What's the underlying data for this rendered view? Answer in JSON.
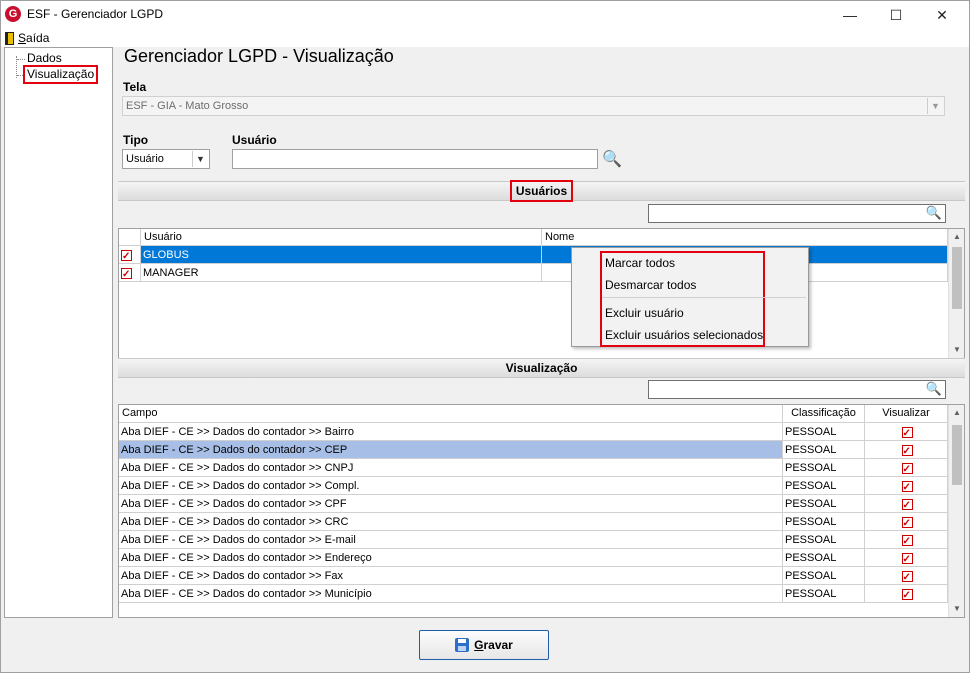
{
  "window": {
    "title": "ESF - Gerenciador LGPD",
    "app_icon_letter": "G",
    "minimize": "—",
    "maximize": "☐",
    "close": "✕"
  },
  "menu": {
    "exit_label_u": "S",
    "exit_label_rest": "aída"
  },
  "tree": {
    "items": [
      "Dados",
      "Visualização"
    ]
  },
  "page": {
    "title": "Gerenciador LGPD - Visualização"
  },
  "tela": {
    "label": "Tela",
    "value": "ESF - GIA - Mato Grosso"
  },
  "tipo": {
    "label": "Tipo",
    "value": "Usuário"
  },
  "usuario_field": {
    "label": "Usuário",
    "value": ""
  },
  "usuarios_section": {
    "header": "Usuários",
    "columns": [
      "Usuário",
      "Nome"
    ],
    "rows": [
      {
        "user": "GLOBUS",
        "name": "",
        "checked": true,
        "selected": true
      },
      {
        "user": "MANAGER",
        "name": "",
        "checked": true,
        "selected": false
      }
    ]
  },
  "context_menu": {
    "items": [
      "Marcar todos",
      "Desmarcar todos",
      "Excluir usuário",
      "Excluir usuários selecionados"
    ]
  },
  "visualizacao_section": {
    "header": "Visualização",
    "columns": [
      "Campo",
      "Classificação",
      "Visualizar"
    ],
    "rows": [
      {
        "campo": "Aba DIEF - CE >> Dados do contador >> Bairro",
        "classificacao": "PESSOAL",
        "visualizar": true
      },
      {
        "campo": "Aba DIEF - CE >> Dados do contador >> CEP",
        "classificacao": "PESSOAL",
        "visualizar": true
      },
      {
        "campo": "Aba DIEF - CE >> Dados do contador >> CNPJ",
        "classificacao": "PESSOAL",
        "visualizar": true
      },
      {
        "campo": "Aba DIEF - CE >> Dados do contador >> Compl.",
        "classificacao": "PESSOAL",
        "visualizar": true
      },
      {
        "campo": "Aba DIEF - CE >> Dados do contador >> CPF",
        "classificacao": "PESSOAL",
        "visualizar": true
      },
      {
        "campo": "Aba DIEF - CE >> Dados do contador >> CRC",
        "classificacao": "PESSOAL",
        "visualizar": true
      },
      {
        "campo": "Aba DIEF - CE >> Dados do contador >> E-mail",
        "classificacao": "PESSOAL",
        "visualizar": true
      },
      {
        "campo": "Aba DIEF - CE >> Dados do contador >> Endereço",
        "classificacao": "PESSOAL",
        "visualizar": true
      },
      {
        "campo": "Aba DIEF - CE >> Dados do contador >> Fax",
        "classificacao": "PESSOAL",
        "visualizar": true
      },
      {
        "campo": "Aba DIEF - CE >> Dados do contador >> Município",
        "classificacao": "PESSOAL",
        "visualizar": true
      }
    ]
  },
  "save_button": {
    "label_u": "G",
    "label_rest": "ravar"
  },
  "colors": {
    "selection": "#0078d7",
    "selection_light": "#a7bfe6",
    "highlight_box": "#e3000f"
  }
}
